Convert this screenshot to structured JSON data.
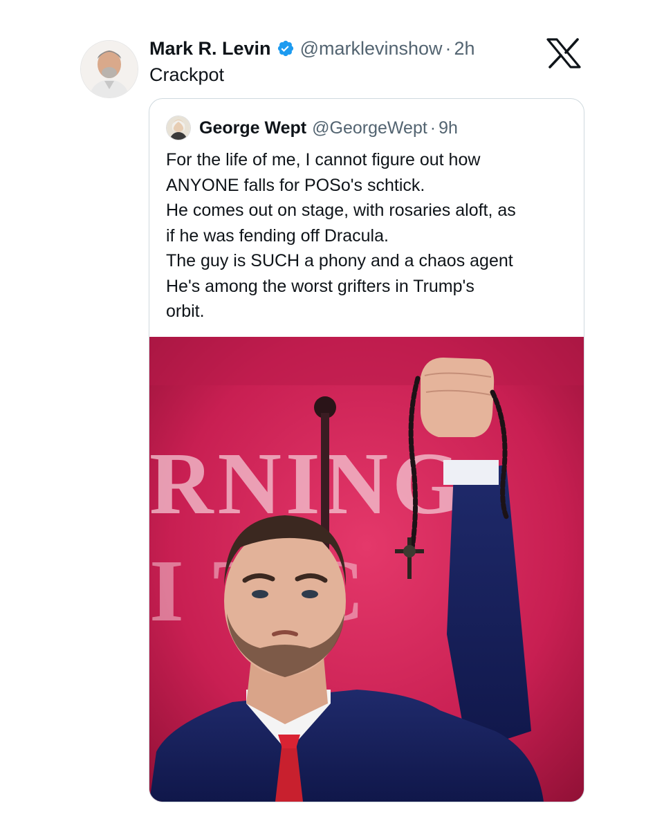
{
  "tweet": {
    "author_name": "Mark R. Levin",
    "handle": "@marklevinshow",
    "separator": "·",
    "time": "2h",
    "text": "Crackpot",
    "verified_icon": "verified-badge-icon",
    "brand_icon": "x-logo-icon"
  },
  "quoted_tweet": {
    "author_name": "George Wept",
    "handle": "@GeorgeWept",
    "separator": "·",
    "time": "9h",
    "lines": [
      "For the life of me, I cannot figure out how",
      "ANYONE falls for POSo's schtick.",
      "He comes out on stage, with rosaries aloft, as",
      "if he was fending off Dracula.",
      "The guy is SUCH a phony and a chaos agent",
      "He's among the worst grifters in Trump's",
      "orbit."
    ],
    "media": {
      "background_letters_top": "RNING",
      "background_letters_bottom": "I  T  C"
    }
  },
  "colors": {
    "text_primary": "#0f1419",
    "text_secondary": "#536471",
    "verified_blue": "#1d9bf0",
    "card_border": "#cfd9de",
    "stage_red": "#c41e4e"
  }
}
